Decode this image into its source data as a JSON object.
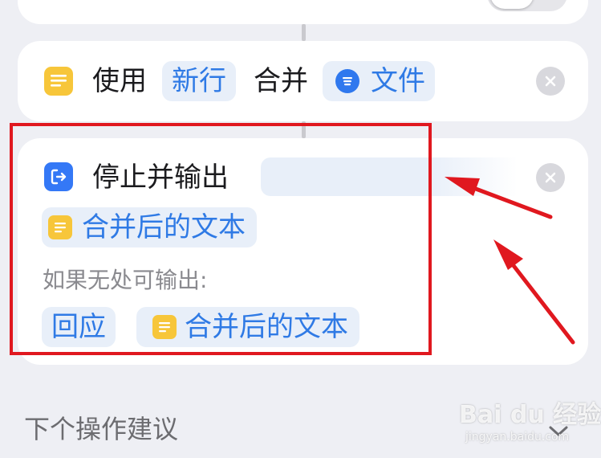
{
  "merge_action": {
    "verb": "使用",
    "separator": "新行",
    "action": "合并",
    "variable": "文件"
  },
  "stop_action": {
    "title": "停止并输出",
    "output_variable": "合并后的文本",
    "fallback_label": "如果无处可输出:",
    "fallback_option": "回应",
    "fallback_variable": "合并后的文本"
  },
  "suggestions": {
    "title": "下个操作建议"
  },
  "watermark": {
    "text": "Bai du 经验",
    "sub": "jingyan.baidu.com"
  },
  "colors": {
    "background": "#EEEFF4",
    "card": "#FFFFFF",
    "accent_blue": "#2F7AE5",
    "pill_background": "#E8EFF9",
    "icon_yellow": "#F7C63A",
    "icon_blue": "#3478F6",
    "annotation_red": "#E0181F"
  },
  "icons": [
    "text-icon",
    "file-icon",
    "exit-icon",
    "close-icon",
    "chevron-down-icon",
    "annotation-arrow"
  ]
}
